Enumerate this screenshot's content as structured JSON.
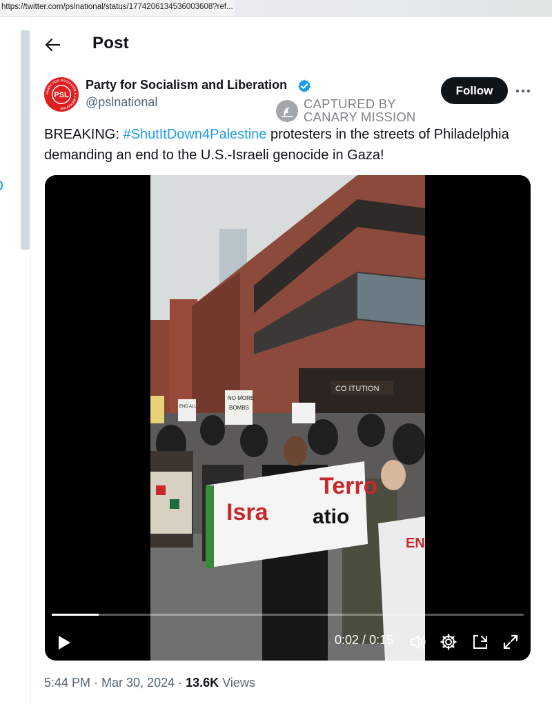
{
  "browser": {
    "url": "https://twitter.com/pslnational/status/1774206134536003608?ref..."
  },
  "header": {
    "title": "Post"
  },
  "author": {
    "name": "Party for Socialism and Liberation",
    "handle": "@pslnational",
    "avatar_text": "PSL",
    "avatar_ring_text": "PARTY FOR SOCIALISM & LIBERATION"
  },
  "watermark": {
    "line1": "CAPTURED BY",
    "line2": "CANARY MISSION"
  },
  "actions": {
    "follow_label": "Follow"
  },
  "tweet": {
    "prefix": "BREAKING: ",
    "hashtag": "#ShutItDown4Palestine",
    "body": "  protesters in the streets of Philadelphia demanding an end to the U.S.-Israeli genocide in Gaza!"
  },
  "video": {
    "current_time": "0:02",
    "duration": "0:15",
    "time_separator": " / ",
    "progress": 0.1,
    "scene_text": {
      "storefront": "CO  ITUTION",
      "sign_no_more": "NO MORE",
      "sign_bombs": "BOMBS",
      "banner_left": "Isra",
      "banner_right": "Terro",
      "banner_bottom": "atio",
      "sign_right": "EN",
      "sign_small": "END ALL"
    }
  },
  "meta": {
    "time": "5:44 PM",
    "date": "Mar 30, 2024",
    "separator": " · ",
    "views_count": "13.6K",
    "views_label": "Views"
  },
  "colors": {
    "accent": "#1d9bf0",
    "text_primary": "#0f1419",
    "text_secondary": "#536471",
    "avatar_red": "#e02020",
    "brick": "#8b4a3c"
  },
  "icons": {
    "back": "arrow-left-icon",
    "verified": "verified-badge-icon",
    "more": "more-horizontal-icon",
    "play": "play-icon",
    "volume": "volume-icon",
    "settings": "gear-icon",
    "pip": "picture-in-picture-icon",
    "fullscreen": "fullscreen-icon"
  }
}
